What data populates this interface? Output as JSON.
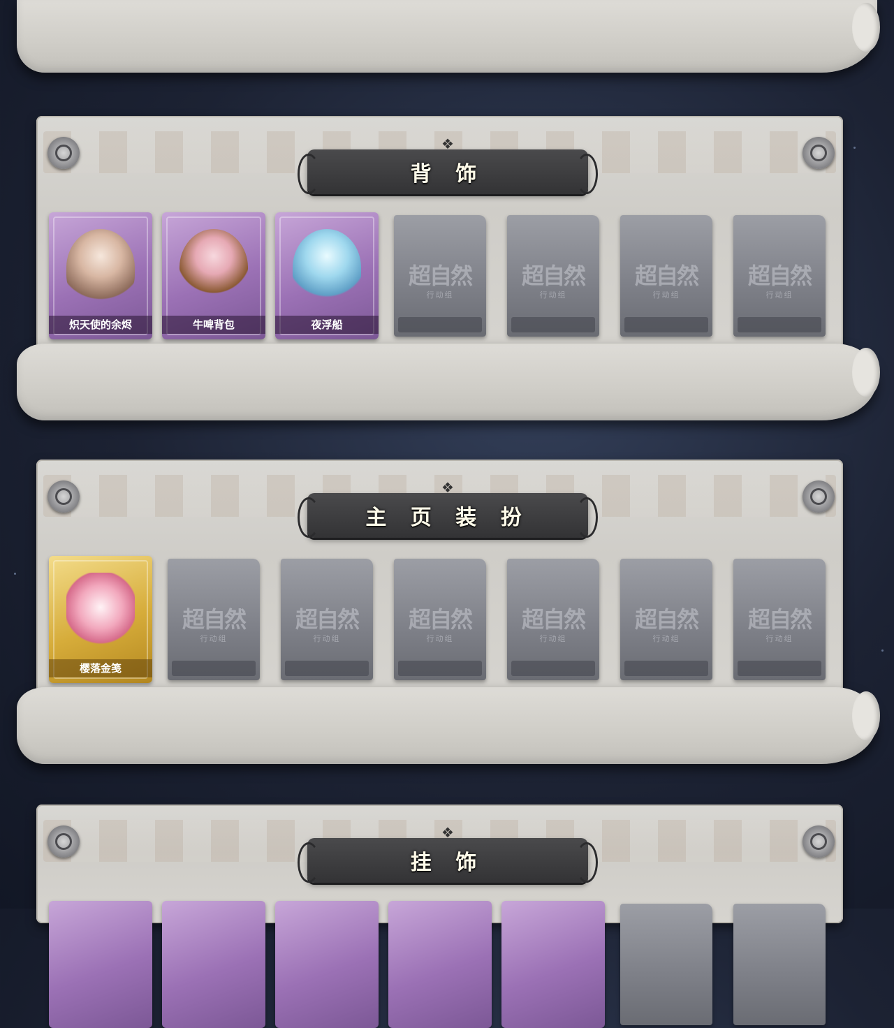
{
  "sections": [
    {
      "title": "背 饰",
      "items": [
        {
          "name": "炽天使的余烬",
          "rarity": "purple",
          "icon": "angel-figure-icon"
        },
        {
          "name": "牛啤背包",
          "rarity": "purple",
          "icon": "cow-beer-mug-icon"
        },
        {
          "name": "夜浮船",
          "rarity": "purple",
          "icon": "jellyfish-icon"
        },
        {
          "locked": true
        },
        {
          "locked": true
        },
        {
          "locked": true
        },
        {
          "locked": true
        }
      ]
    },
    {
      "title": "主 页 装 扮",
      "items": [
        {
          "name": "樱落金笺",
          "rarity": "gold",
          "icon": "cherry-blossom-letter-icon"
        },
        {
          "locked": true
        },
        {
          "locked": true
        },
        {
          "locked": true
        },
        {
          "locked": true
        },
        {
          "locked": true
        },
        {
          "locked": true
        }
      ]
    },
    {
      "title": "挂 饰",
      "items": []
    }
  ],
  "locked_logo": {
    "main": "超自然",
    "sub": "行动组"
  },
  "colors": {
    "purple": "#9b71b5",
    "gold": "#d6ac3a",
    "locked": "#7d7f87",
    "title_plate": "#3c3c3e"
  }
}
